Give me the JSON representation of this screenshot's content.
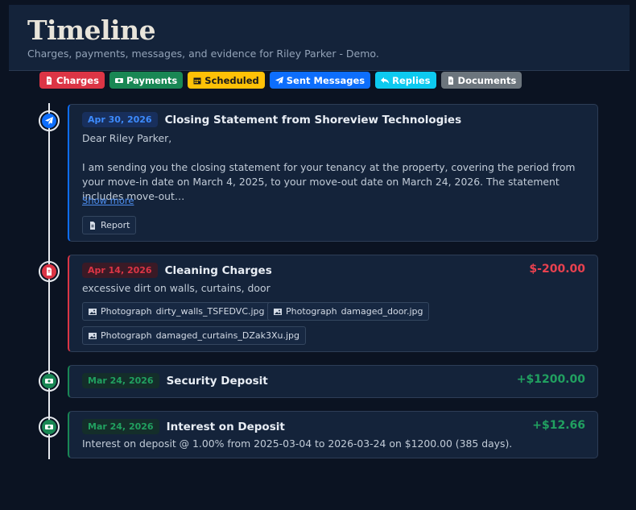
{
  "header": {
    "title": "Timeline",
    "subtitle": "Charges, payments, messages, and evidence for Riley Parker - Demo."
  },
  "filters": [
    {
      "label": "Charges",
      "bg": "#dc3545",
      "fg": "#ffffff",
      "icon": "invoice-icon"
    },
    {
      "label": "Payments",
      "bg": "#198754",
      "fg": "#ffffff",
      "icon": "money-icon"
    },
    {
      "label": "Scheduled",
      "bg": "#ffc107",
      "fg": "#1a1a1a",
      "icon": "calendar-icon"
    },
    {
      "label": "Sent Messages",
      "bg": "#0d6efd",
      "fg": "#ffffff",
      "icon": "send-icon"
    },
    {
      "label": "Replies",
      "bg": "#0dcaf0",
      "fg": "#0b1322",
      "icon": "reply-icon"
    },
    {
      "label": "Documents",
      "bg": "#6c757d",
      "fg": "#ffffff",
      "icon": "document-icon"
    }
  ],
  "events": [
    {
      "date": "Apr 30, 2026",
      "title": "Closing Statement from Shoreview Technologies",
      "greeting": "Dear Riley Parker,",
      "body": "I am sending you the closing statement for your tenancy at the property, covering the period from your move-in date on March 4, 2025, to your move-out date on March 24, 2026. The statement includes move-out…",
      "show_more": "Show more",
      "attachments": [
        {
          "label": "Report"
        }
      ]
    },
    {
      "date": "Apr 14, 2026",
      "title": "Cleaning Charges",
      "amount": "$-200.00",
      "body": "excessive dirt on walls, curtains, door",
      "attachments": [
        {
          "kind": "Photograph",
          "file": "dirty_walls_TSFEDVC.jpg"
        },
        {
          "kind": "Photograph",
          "file": "damaged_door.jpg"
        },
        {
          "kind": "Photograph",
          "file": "damaged_curtains_DZak3Xu.jpg"
        }
      ]
    },
    {
      "date": "Mar 24, 2026",
      "title": "Security Deposit",
      "amount": "+$1200.00"
    },
    {
      "date": "Mar 24, 2026",
      "title": "Interest on Deposit",
      "amount": "+$12.66",
      "body": "Interest on deposit @ 1.00% from 2025-03-04 to 2026-03-24 on $1200.00 (385 days)."
    }
  ],
  "colors": {
    "message": "#0d6efd",
    "charge": "#dc3545",
    "payment": "#198754",
    "charge_amount": "#e8414f",
    "payment_amount": "#21a060"
  }
}
